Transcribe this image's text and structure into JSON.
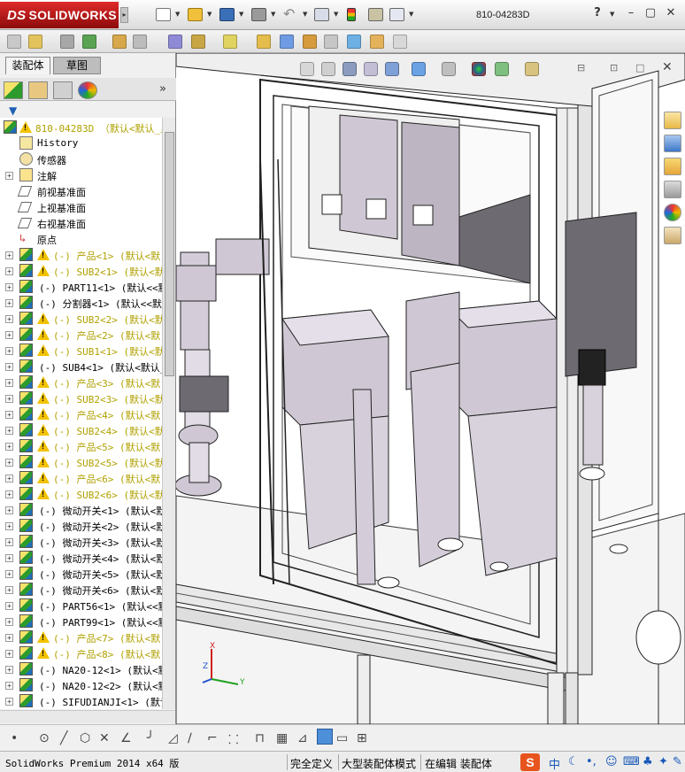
{
  "titlebar": {
    "brand": "SOLIDWORKS",
    "brand_prefix": "DS",
    "document_title": "810-04283D",
    "help_label": "?",
    "minimize": "–",
    "restore": "▢",
    "close": "✕"
  },
  "panel": {
    "tab_assembly": "装配体",
    "tab_sketch": "草图",
    "expand": "»",
    "filter": "▼"
  },
  "tree": {
    "root": "810-04283D （默认<默认_显",
    "items": [
      {
        "label": "History",
        "expand": false,
        "icon": "history-icon",
        "warn": false,
        "yellow": false
      },
      {
        "label": "传感器",
        "expand": false,
        "icon": "sensor-icon",
        "warn": false,
        "yellow": false
      },
      {
        "label": "注解",
        "expand": true,
        "icon": "annotation-icon",
        "warn": false,
        "yellow": false
      },
      {
        "label": "前视基准面",
        "expand": false,
        "icon": "plane-icon",
        "warn": false,
        "yellow": false
      },
      {
        "label": "上视基准面",
        "expand": false,
        "icon": "plane-icon",
        "warn": false,
        "yellow": false
      },
      {
        "label": "右视基准面",
        "expand": false,
        "icon": "plane-icon",
        "warn": false,
        "yellow": false
      },
      {
        "label": "原点",
        "expand": false,
        "icon": "origin-icon",
        "warn": false,
        "yellow": false
      },
      {
        "label": "(-) 产品<1> (默认<默",
        "expand": true,
        "icon": "assembly-icon",
        "warn": true,
        "yellow": true
      },
      {
        "label": "(-) SUB2<1> (默认<默",
        "expand": true,
        "icon": "assembly-icon",
        "warn": true,
        "yellow": true
      },
      {
        "label": "(-) PART11<1> (默认<<默",
        "expand": true,
        "icon": "part-icon",
        "warn": false,
        "yellow": false
      },
      {
        "label": "(-) 分割器<1> (默认<<默",
        "expand": true,
        "icon": "part-icon",
        "warn": false,
        "yellow": false
      },
      {
        "label": "(-) SUB2<2> (默认<默",
        "expand": true,
        "icon": "assembly-icon",
        "warn": true,
        "yellow": true
      },
      {
        "label": "(-) 产品<2> (默认<默",
        "expand": true,
        "icon": "assembly-icon",
        "warn": true,
        "yellow": true
      },
      {
        "label": "(-) SUB1<1> (默认<默",
        "expand": true,
        "icon": "assembly-icon",
        "warn": true,
        "yellow": true
      },
      {
        "label": "(-) SUB4<1> (默认<默认_",
        "expand": true,
        "icon": "assembly-icon",
        "warn": false,
        "yellow": false
      },
      {
        "label": "(-) 产品<3> (默认<默",
        "expand": true,
        "icon": "assembly-icon",
        "warn": true,
        "yellow": true
      },
      {
        "label": "(-) SUB2<3> (默认<默",
        "expand": true,
        "icon": "assembly-icon",
        "warn": true,
        "yellow": true
      },
      {
        "label": "(-) 产品<4> (默认<默",
        "expand": true,
        "icon": "assembly-icon",
        "warn": true,
        "yellow": true
      },
      {
        "label": "(-) SUB2<4> (默认<默",
        "expand": true,
        "icon": "assembly-icon",
        "warn": true,
        "yellow": true
      },
      {
        "label": "(-) 产品<5> (默认<默",
        "expand": true,
        "icon": "assembly-icon",
        "warn": true,
        "yellow": true
      },
      {
        "label": "(-) SUB2<5> (默认<默",
        "expand": true,
        "icon": "assembly-icon",
        "warn": true,
        "yellow": true
      },
      {
        "label": "(-) 产品<6> (默认<默",
        "expand": true,
        "icon": "assembly-icon",
        "warn": true,
        "yellow": true
      },
      {
        "label": "(-) SUB2<6> (默认<默",
        "expand": true,
        "icon": "assembly-icon",
        "warn": true,
        "yellow": true
      },
      {
        "label": "(-) 微动开关<1> (默认<默",
        "expand": true,
        "icon": "assembly-icon",
        "warn": false,
        "yellow": false
      },
      {
        "label": "(-) 微动开关<2> (默认<默",
        "expand": true,
        "icon": "assembly-icon",
        "warn": false,
        "yellow": false
      },
      {
        "label": "(-) 微动开关<3> (默认<默",
        "expand": true,
        "icon": "assembly-icon",
        "warn": false,
        "yellow": false
      },
      {
        "label": "(-) 微动开关<4> (默认<默",
        "expand": true,
        "icon": "assembly-icon",
        "warn": false,
        "yellow": false
      },
      {
        "label": "(-) 微动开关<5> (默认<默",
        "expand": true,
        "icon": "assembly-icon",
        "warn": false,
        "yellow": false
      },
      {
        "label": "(-) 微动开关<6> (默认<默",
        "expand": true,
        "icon": "assembly-icon",
        "warn": false,
        "yellow": false
      },
      {
        "label": "(-) PART56<1> (默认<<默",
        "expand": true,
        "icon": "part-icon",
        "warn": false,
        "yellow": false
      },
      {
        "label": "(-) PART99<1> (默认<<默",
        "expand": true,
        "icon": "part-icon",
        "warn": false,
        "yellow": false
      },
      {
        "label": "(-) 产品<7> (默认<默",
        "expand": true,
        "icon": "assembly-icon",
        "warn": true,
        "yellow": true
      },
      {
        "label": "(-) 产品<8> (默认<默",
        "expand": true,
        "icon": "assembly-icon",
        "warn": true,
        "yellow": true
      },
      {
        "label": "(-) NA20-12<1> (默认<默",
        "expand": true,
        "icon": "assembly-icon",
        "warn": false,
        "yellow": false
      },
      {
        "label": "(-) NA20-12<2> (默认<默",
        "expand": true,
        "icon": "assembly-icon",
        "warn": false,
        "yellow": false
      },
      {
        "label": "(-) SIFUDIANJI<1> (默认<",
        "expand": true,
        "icon": "assembly-icon",
        "warn": false,
        "yellow": false
      }
    ]
  },
  "viewport": {
    "triad_x": "X",
    "triad_y": "Y",
    "triad_z": "Z"
  },
  "status": {
    "product": "SolidWorks Premium 2014 x64 版",
    "definition": "完全定义",
    "mode": "大型装配体模式",
    "editing": "在编辑 装配体",
    "ime_zh": "中"
  },
  "colors": {
    "tree_yellow": "#b0a100",
    "model_fill": "#cfc8d4",
    "model_dark": "#6e6a72",
    "frame": "#e6e6e6"
  }
}
